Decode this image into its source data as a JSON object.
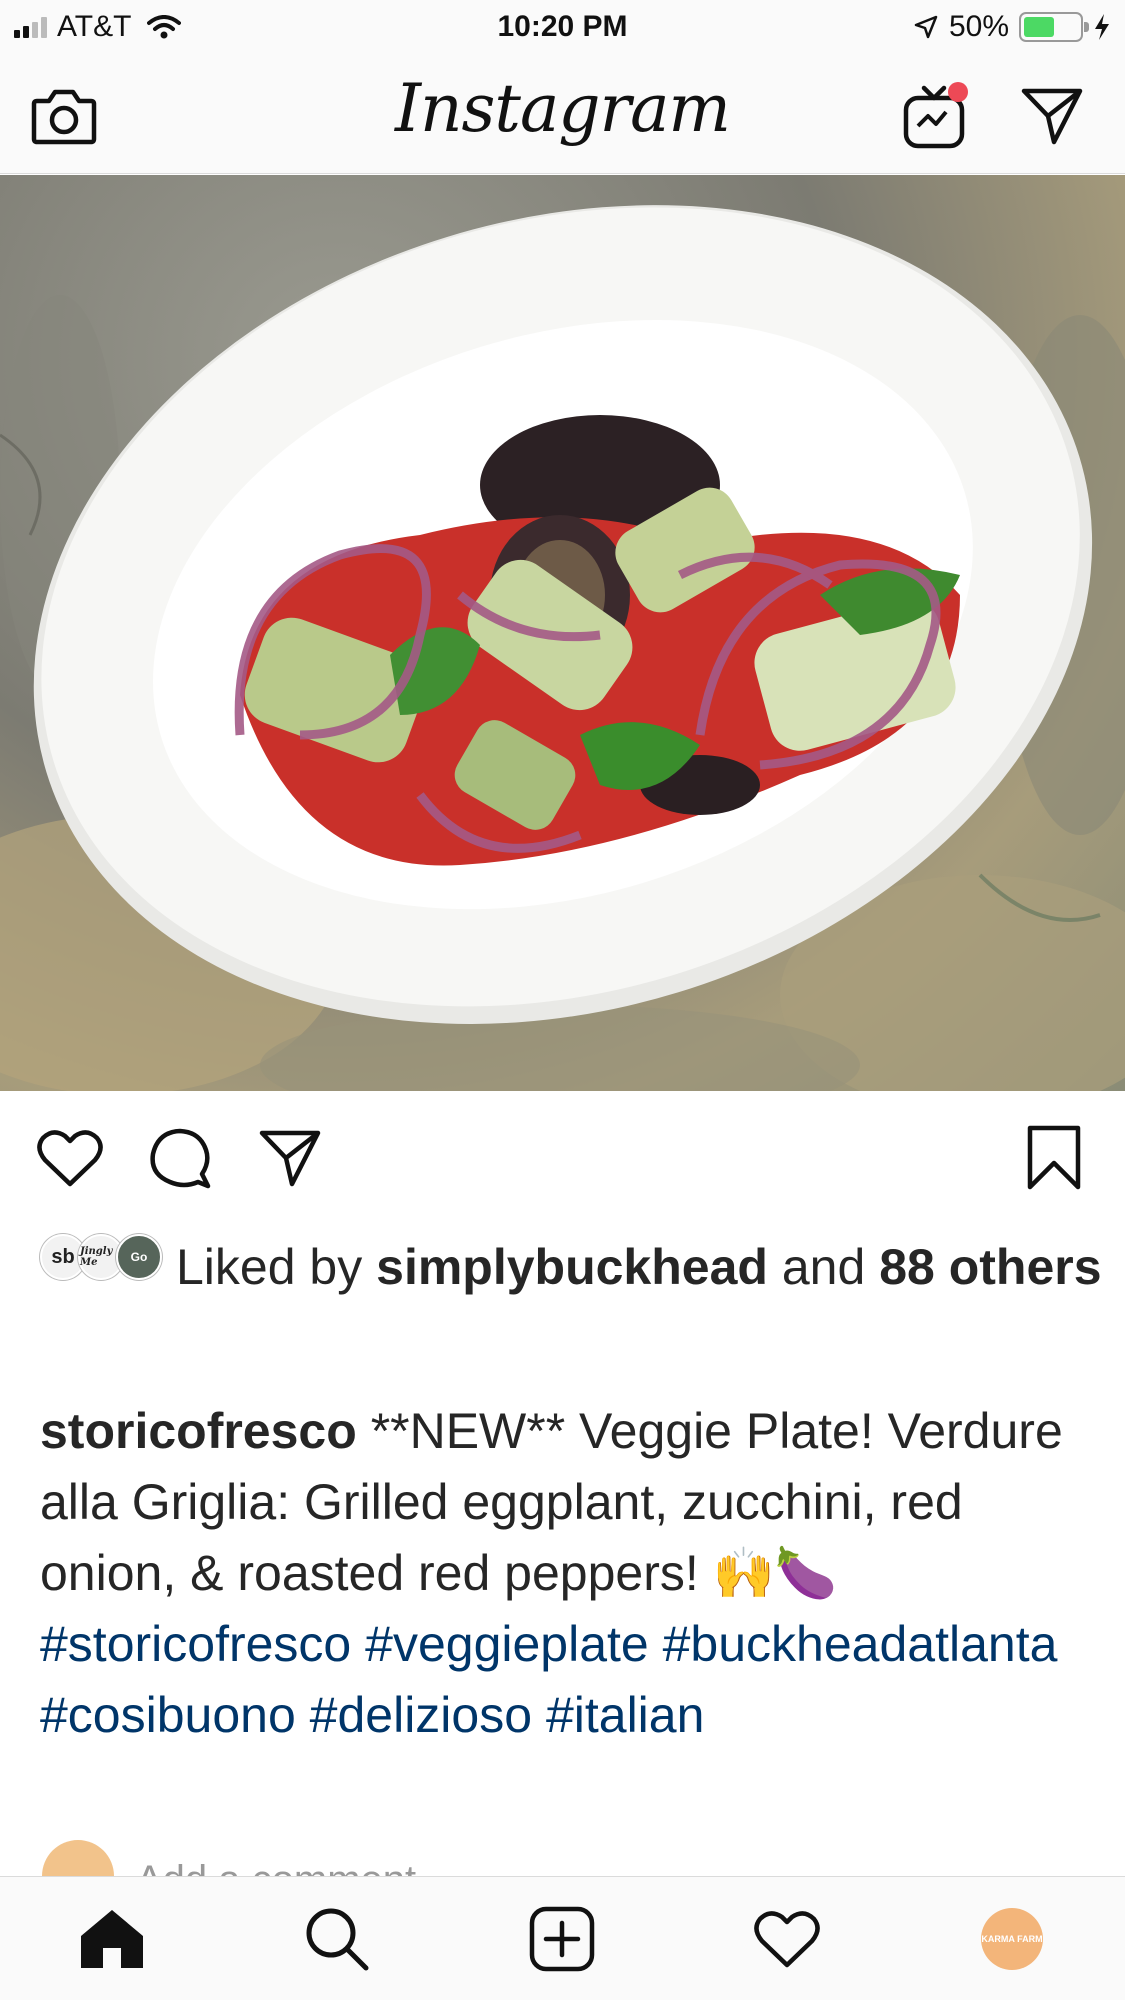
{
  "status_bar": {
    "carrier": "AT&T",
    "time": "10:20 PM",
    "battery_percent": "50%",
    "battery_level": 0.5,
    "signal_bars": 2
  },
  "header": {
    "app_title": "Instagram",
    "icons": {
      "left": "camera-icon",
      "igtv": "igtv-icon",
      "direct": "direct-message-icon"
    },
    "igtv_badge_color": "#ed4956"
  },
  "post": {
    "image_alt": "Grilled veggie plate on white dish",
    "actions": [
      "heart-icon",
      "comment-icon",
      "share-icon",
      "bookmark-icon"
    ],
    "likes": {
      "prefix": "Liked by",
      "user": "simplybuckhead",
      "middle": "and",
      "count": "88",
      "suffix": "others",
      "avatar_labels": [
        "sb",
        "Jingly Me",
        "Go"
      ]
    },
    "caption": {
      "username": "storicofresco",
      "text": "**NEW** Veggie Plate! Verdure alla Griglia: Grilled eggplant, zucchini, red onion, & roasted red peppers! 🙌🍆",
      "hashtags": [
        "#storicofresco",
        "#veggieplate",
        "#buckheadatlanta",
        "#cosibuono",
        "#delizioso",
        "#italian"
      ]
    },
    "add_comment_placeholder": "Add a comment..."
  },
  "tab_bar": {
    "items": [
      "home-icon",
      "search-icon",
      "new-post-icon",
      "activity-icon",
      "profile-avatar"
    ],
    "profile_label": "KARMA FARM"
  },
  "colors": {
    "hashtag": "#003569",
    "text": "#262626",
    "border": "#dbdbdb",
    "battery_fill": "#4cd964"
  }
}
